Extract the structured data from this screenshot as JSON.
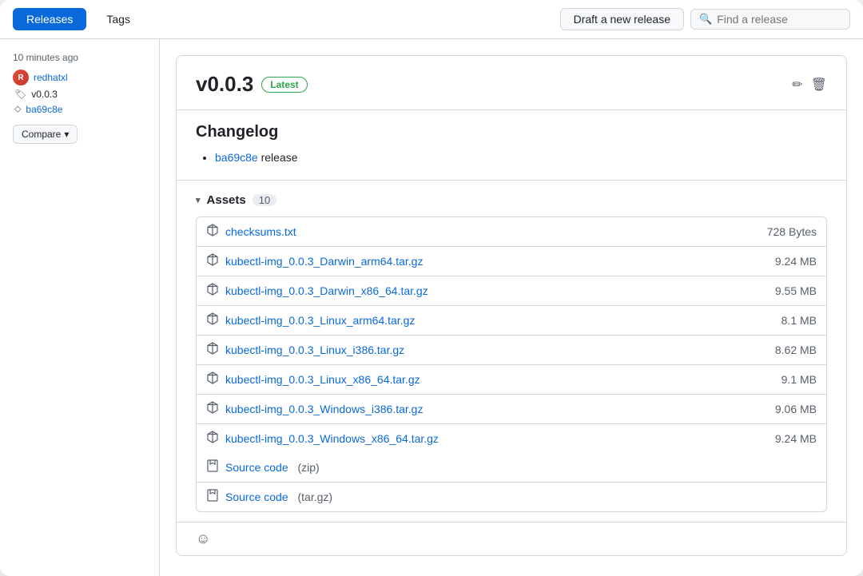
{
  "topbar": {
    "tabs": [
      {
        "id": "releases",
        "label": "Releases",
        "active": true
      },
      {
        "id": "tags",
        "label": "Tags",
        "active": false
      }
    ],
    "draft_button_label": "Draft a new release",
    "search_placeholder": "Find a release"
  },
  "sidebar": {
    "time_ago": "10 minutes ago",
    "user": {
      "name": "redhatxl",
      "avatar_initial": "R"
    },
    "tag": "v0.0.3",
    "commit_hash": "ba69c8e",
    "compare_label": "Compare"
  },
  "release": {
    "version": "v0.0.3",
    "latest_badge": "Latest",
    "changelog_title": "Changelog",
    "changelog_items": [
      {
        "link": "ba69c8e",
        "text": "release"
      }
    ],
    "assets_label": "Assets",
    "assets_count": "10",
    "assets": [
      {
        "name": "checksums.txt",
        "size": "728 Bytes",
        "type": "package"
      },
      {
        "name": "kubectl-img_0.0.3_Darwin_arm64.tar.gz",
        "size": "9.24 MB",
        "type": "package"
      },
      {
        "name": "kubectl-img_0.0.3_Darwin_x86_64.tar.gz",
        "size": "9.55 MB",
        "type": "package"
      },
      {
        "name": "kubectl-img_0.0.3_Linux_arm64.tar.gz",
        "size": "8.1 MB",
        "type": "package"
      },
      {
        "name": "kubectl-img_0.0.3_Linux_i386.tar.gz",
        "size": "8.62 MB",
        "type": "package"
      },
      {
        "name": "kubectl-img_0.0.3_Linux_x86_64.tar.gz",
        "size": "9.1 MB",
        "type": "package"
      },
      {
        "name": "kubectl-img_0.0.3_Windows_i386.tar.gz",
        "size": "9.06 MB",
        "type": "package"
      },
      {
        "name": "kubectl-img_0.0.3_Windows_x86_64.tar.gz",
        "size": "9.24 MB",
        "type": "package"
      }
    ],
    "sources": [
      {
        "name": "Source code",
        "suffix": "(zip)"
      },
      {
        "name": "Source code",
        "suffix": "(tar.gz)"
      }
    ]
  },
  "icons": {
    "search": "🔍",
    "tag": "🏷",
    "commit": "⬦",
    "chevron_down": "▾",
    "edit": "✏",
    "trash": "🗑",
    "package": "📦",
    "file_zip": "📄",
    "emoji_smile": "☺"
  }
}
